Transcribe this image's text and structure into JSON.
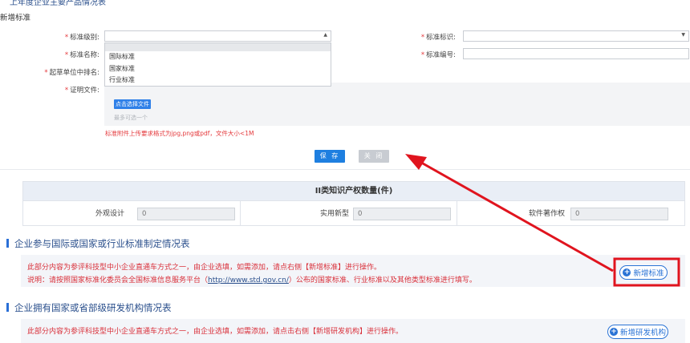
{
  "page": {
    "top_partial_heading": "上年度企业主要产品情况表",
    "ip_table": {
      "title": "II类知识产权数量(件)",
      "cells": [
        {
          "label": "外观设计",
          "value": "0"
        },
        {
          "label": "实用新型",
          "value": "0"
        },
        {
          "label": "软件著作权",
          "value": "0"
        }
      ]
    },
    "standards_section": {
      "heading": "企业参与国际或国家或行业标准制定情况表",
      "line1": "此部分内容为参评科技型中小企业直通车方式之一，由企业选填，如需添加，请点右侧【新增标准】进行操作。",
      "line2_prefix": "说明：请按照国家标准化委员会全国标准信息服务平台（",
      "line2_link": "http://www.std.gov.cn/",
      "line2_suffix": "）公布的国家标准、行业标准以及其他类型标准进行填写。",
      "add_button": "新增标准"
    },
    "rd_section": {
      "heading": "企业拥有国家或省部级研发机构情况表",
      "line1": "此部分内容为参评科技型中小企业直通车方式之一，由企业选填，如需添加，请点击右侧【新增研发机构】进行操作。",
      "add_button": "新增研发机构"
    }
  },
  "modal": {
    "title": "新增标准",
    "fields": {
      "level_label": "标准级别:",
      "mark_label": "标准标识:",
      "name_label": "标准名称:",
      "number_label": "标准编号:",
      "rank_label": "起草单位中排名:",
      "file_label": "证明文件:"
    },
    "level_options": [
      "国际标准",
      "国家标准",
      "行业标准"
    ],
    "upload": {
      "button": "点击选择文件",
      "hint": "最多可选一个",
      "note": "标准附件上传要求格式为jpg,png或pdf，文件大小<1M"
    },
    "save_button": "保 存",
    "close_button": "关 闭"
  },
  "colors": {
    "primary": "#1e7fe0",
    "required_star": "#e4393c",
    "annotation_red": "#e0141e"
  }
}
